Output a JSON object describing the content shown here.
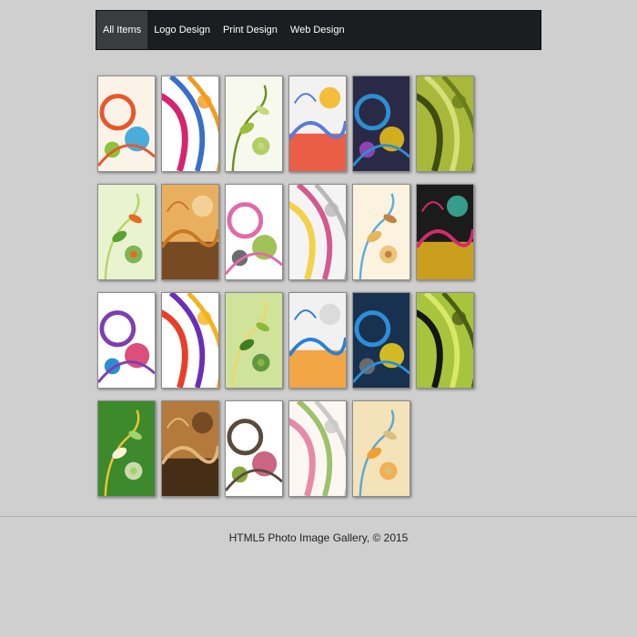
{
  "nav": {
    "items": [
      {
        "label": "All Items",
        "active": true
      },
      {
        "label": "Logo Design",
        "active": false
      },
      {
        "label": "Print Design",
        "active": false
      },
      {
        "label": "Web Design",
        "active": false
      }
    ]
  },
  "gallery": {
    "items": [
      {
        "name": "colorful-circles-art",
        "colors": [
          "#fbf3e8",
          "#e8562a",
          "#2a9fd8",
          "#8ac43f"
        ]
      },
      {
        "name": "colorful-swirl-art",
        "colors": [
          "#ffffff",
          "#d6246e",
          "#3a6fc9",
          "#f29b1d"
        ]
      },
      {
        "name": "green-floral-art",
        "colors": [
          "#f7f9ef",
          "#9bbf3c",
          "#6e8f1f",
          "#c6d97a"
        ]
      },
      {
        "name": "circles-red-arc-art",
        "colors": [
          "#f2f2f2",
          "#e7381b",
          "#5a7bd5",
          "#f4b41a"
        ]
      },
      {
        "name": "rainbow-stripes-art",
        "colors": [
          "#2a2a46",
          "#2c8fd1",
          "#f0c419",
          "#8e44ad"
        ]
      },
      {
        "name": "green-grunge-art",
        "colors": [
          "#a8b93a",
          "#3f4d12",
          "#d5e07a",
          "#6b7d1d"
        ]
      },
      {
        "name": "green-waves-art",
        "colors": [
          "#e9f3cf",
          "#5aa22f",
          "#b7d46b",
          "#e66b1f"
        ]
      },
      {
        "name": "autumn-tree-art",
        "colors": [
          "#e8b05e",
          "#5a3114",
          "#c97823",
          "#f3d6a1"
        ]
      },
      {
        "name": "floral-sketch-art",
        "colors": [
          "#ffffff",
          "#e06aa8",
          "#8fb93a",
          "#6c6c6c"
        ]
      },
      {
        "name": "yellow-rose-sketch-art",
        "colors": [
          "#f4f4f4",
          "#f3d14a",
          "#d25a8f",
          "#b8b8b8"
        ]
      },
      {
        "name": "butterfly-grunge-art",
        "colors": [
          "#fbf3de",
          "#e8b55a",
          "#5aaee0",
          "#c2833e"
        ]
      },
      {
        "name": "tropical-flower-art",
        "colors": [
          "#1b1b1b",
          "#f7c01f",
          "#d42b6b",
          "#3bb3a0"
        ]
      },
      {
        "name": "purple-swirls-art",
        "colors": [
          "#ffffff",
          "#7c3fb0",
          "#d62f64",
          "#2a8fd0"
        ]
      },
      {
        "name": "paisley-petals-art",
        "colors": [
          "#ffffff",
          "#e83f2a",
          "#6a2fb8",
          "#f6b21b"
        ]
      },
      {
        "name": "green-splash-art",
        "colors": [
          "#cfe39a",
          "#3e7d22",
          "#f2d56a",
          "#8ab83d"
        ]
      },
      {
        "name": "orange-circles-art",
        "colors": [
          "#f1f1f1",
          "#f2941c",
          "#2e7fd0",
          "#d7d7d7"
        ]
      },
      {
        "name": "blue-curves-art",
        "colors": [
          "#17314f",
          "#2f8ed8",
          "#f3d21c",
          "#6a6a6a"
        ]
      },
      {
        "name": "city-silhouette-art",
        "colors": [
          "#a8c43c",
          "#151515",
          "#d9e86a",
          "#4c5c14"
        ]
      },
      {
        "name": "white-lily-art",
        "colors": [
          "#3c8a2c",
          "#fbf4d8",
          "#f4c430",
          "#9fd46b"
        ]
      },
      {
        "name": "sepia-grunge-art",
        "colors": [
          "#b37a3c",
          "#2a1a0c",
          "#e2b77a",
          "#6a4322"
        ]
      },
      {
        "name": "vine-pattern-art",
        "colors": [
          "#ffffff",
          "#5a4a3c",
          "#c24a6e",
          "#88a63c"
        ]
      },
      {
        "name": "pink-roses-art",
        "colors": [
          "#fdf7f4",
          "#e58aa8",
          "#9cc26b",
          "#c9c9c9"
        ]
      },
      {
        "name": "orange-floral-art",
        "colors": [
          "#f4e2b8",
          "#f0a030",
          "#5aa9d6",
          "#d7c07a"
        ]
      }
    ]
  },
  "footer": {
    "text": "HTML5 Photo Image Gallery, © 2015"
  }
}
